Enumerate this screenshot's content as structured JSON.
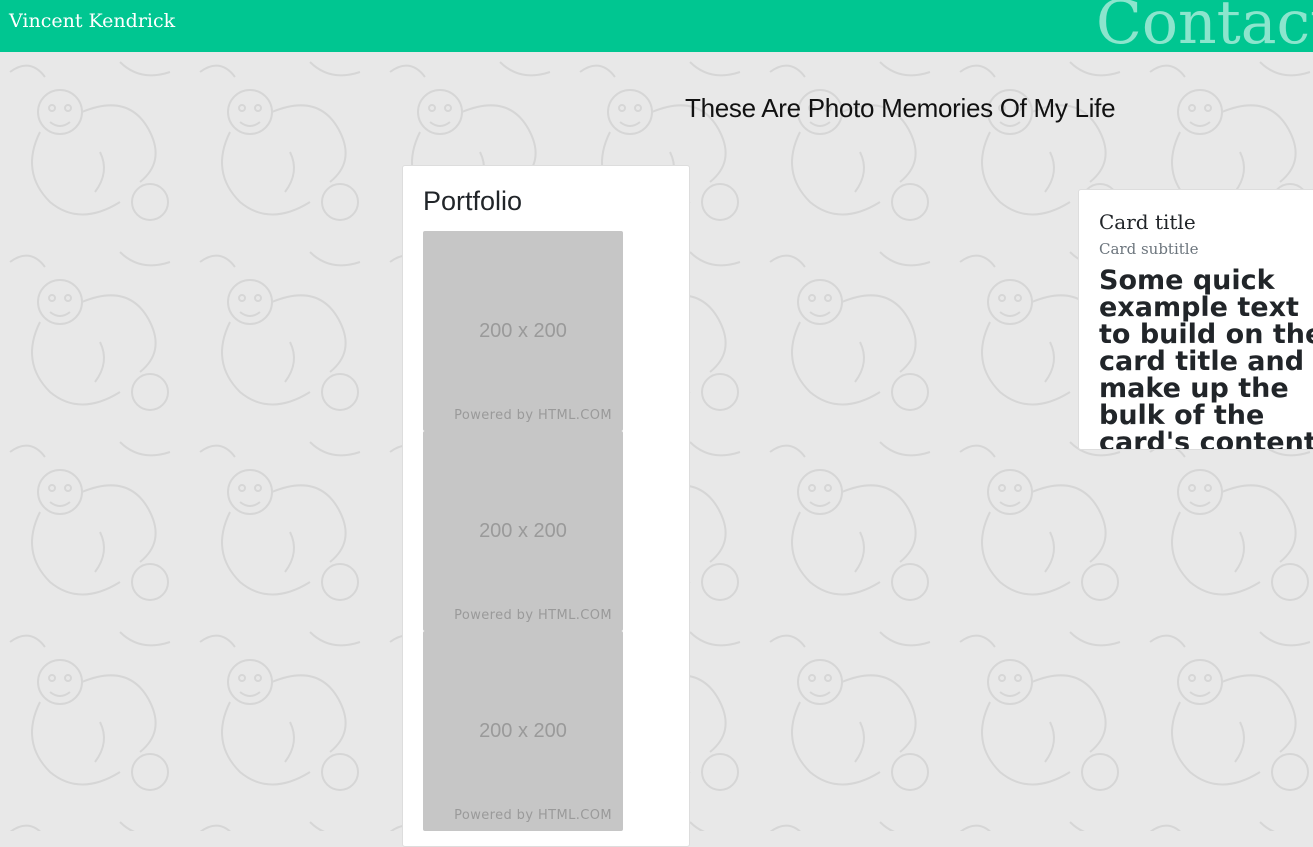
{
  "navbar": {
    "brand": "Vincent Kendrick",
    "contact_link": "Contact",
    "background_color": "#00c691"
  },
  "main": {
    "headline": "These Are Photo Memories Of My Life"
  },
  "portfolio": {
    "title": "Portfolio",
    "photos": [
      {
        "size_label": "200 x 200",
        "credit": "Powered by HTML.COM"
      },
      {
        "size_label": "200 x 200",
        "credit": "Powered by HTML.COM"
      },
      {
        "size_label": "200 x 200",
        "credit": "Powered by HTML.COM"
      }
    ]
  },
  "card": {
    "title": "Card title",
    "subtitle": "Card subtitle",
    "text": "Some quick example text to build on the card title and make up the bulk of the card's content."
  }
}
